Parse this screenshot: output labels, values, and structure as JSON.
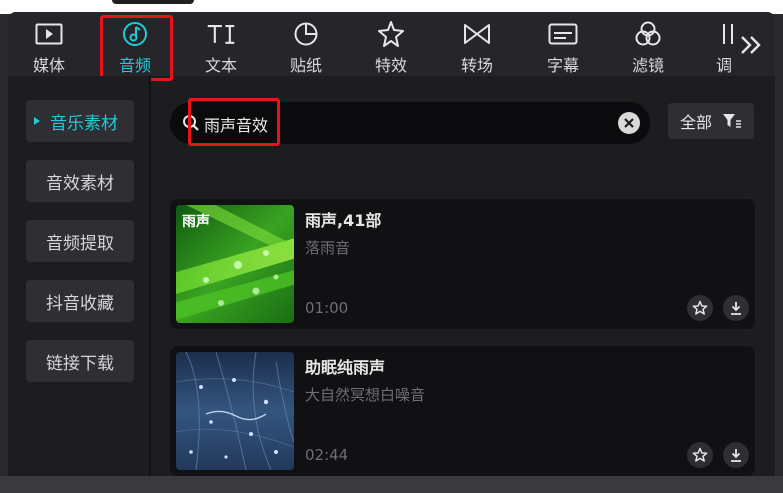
{
  "toolbar": {
    "tabs": [
      {
        "label": "媒体",
        "icon": "media-play-icon"
      },
      {
        "label": "音频",
        "icon": "music-note-icon",
        "active": true
      },
      {
        "label": "文本",
        "icon": "text-ti-icon"
      },
      {
        "label": "贴纸",
        "icon": "sticker-icon"
      },
      {
        "label": "特效",
        "icon": "effect-star-icon"
      },
      {
        "label": "转场",
        "icon": "transition-icon"
      },
      {
        "label": "字幕",
        "icon": "subtitle-icon"
      },
      {
        "label": "滤镜",
        "icon": "filter-circles-icon"
      },
      {
        "label": "调",
        "icon": "adjust-icon"
      }
    ],
    "more_icon": "double-chevron-right-icon"
  },
  "sidebar": {
    "items": [
      {
        "label": "音乐素材",
        "active": true
      },
      {
        "label": "音效素材"
      },
      {
        "label": "音频提取"
      },
      {
        "label": "抖音收藏"
      },
      {
        "label": "链接下载"
      }
    ]
  },
  "search": {
    "query": "雨声音效",
    "search_icon": "search-icon",
    "clear_icon": "clear-icon"
  },
  "filter": {
    "label": "全部",
    "icon": "filter-icon"
  },
  "results": [
    {
      "thumb_label": "雨声",
      "title": "雨声,41部",
      "subtitle": "落雨音",
      "duration": "01:00"
    },
    {
      "thumb_label": "",
      "title": "助眠纯雨声",
      "subtitle": "大自然冥想白噪音",
      "duration": "02:44"
    }
  ],
  "colors": {
    "accent": "#23c9d6",
    "highlight_box": "#e5141b",
    "background": "#1d1d20"
  }
}
